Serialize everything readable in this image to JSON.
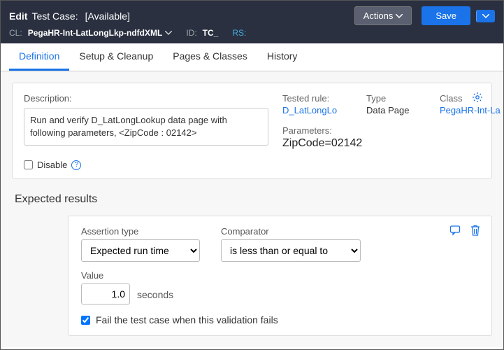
{
  "header": {
    "title_edit": "Edit",
    "title_tc": "Test Case:",
    "availability": "[Available]",
    "actions_label": "Actions",
    "save_label": "Save",
    "cl_label": "CL:",
    "cl_value": "PegaHR-Int-LatLongLkp-ndfdXML",
    "id_label": "ID:",
    "id_value": "TC_",
    "rs_label": "RS:"
  },
  "tabs": [
    {
      "label": "Definition",
      "active": true
    },
    {
      "label": "Setup & Cleanup",
      "active": false
    },
    {
      "label": "Pages & Classes",
      "active": false
    },
    {
      "label": "History",
      "active": false
    }
  ],
  "definition": {
    "description_label": "Description:",
    "description_value": "Run and verify D_LatLongLookup data page with following parameters, <ZipCode : 02142>",
    "tested_label": "Tested rule:",
    "tested_link": "D_LatLongLo",
    "type_label": "Type",
    "type_value": "Data Page",
    "class_label": "Class",
    "class_link": "PegaHR-Int-La",
    "params_label": "Parameters:",
    "params_value": "ZipCode=02142",
    "disable_label": "Disable"
  },
  "expected": {
    "section_title": "Expected results",
    "assertion_type_label": "Assertion type",
    "assertion_type_value": "Expected run time",
    "comparator_label": "Comparator",
    "comparator_value": "is less than or equal to",
    "value_label": "Value",
    "value_input": "1.0",
    "value_unit": "seconds",
    "fail_checked": true,
    "fail_label": "Fail the test case when this validation fails"
  }
}
